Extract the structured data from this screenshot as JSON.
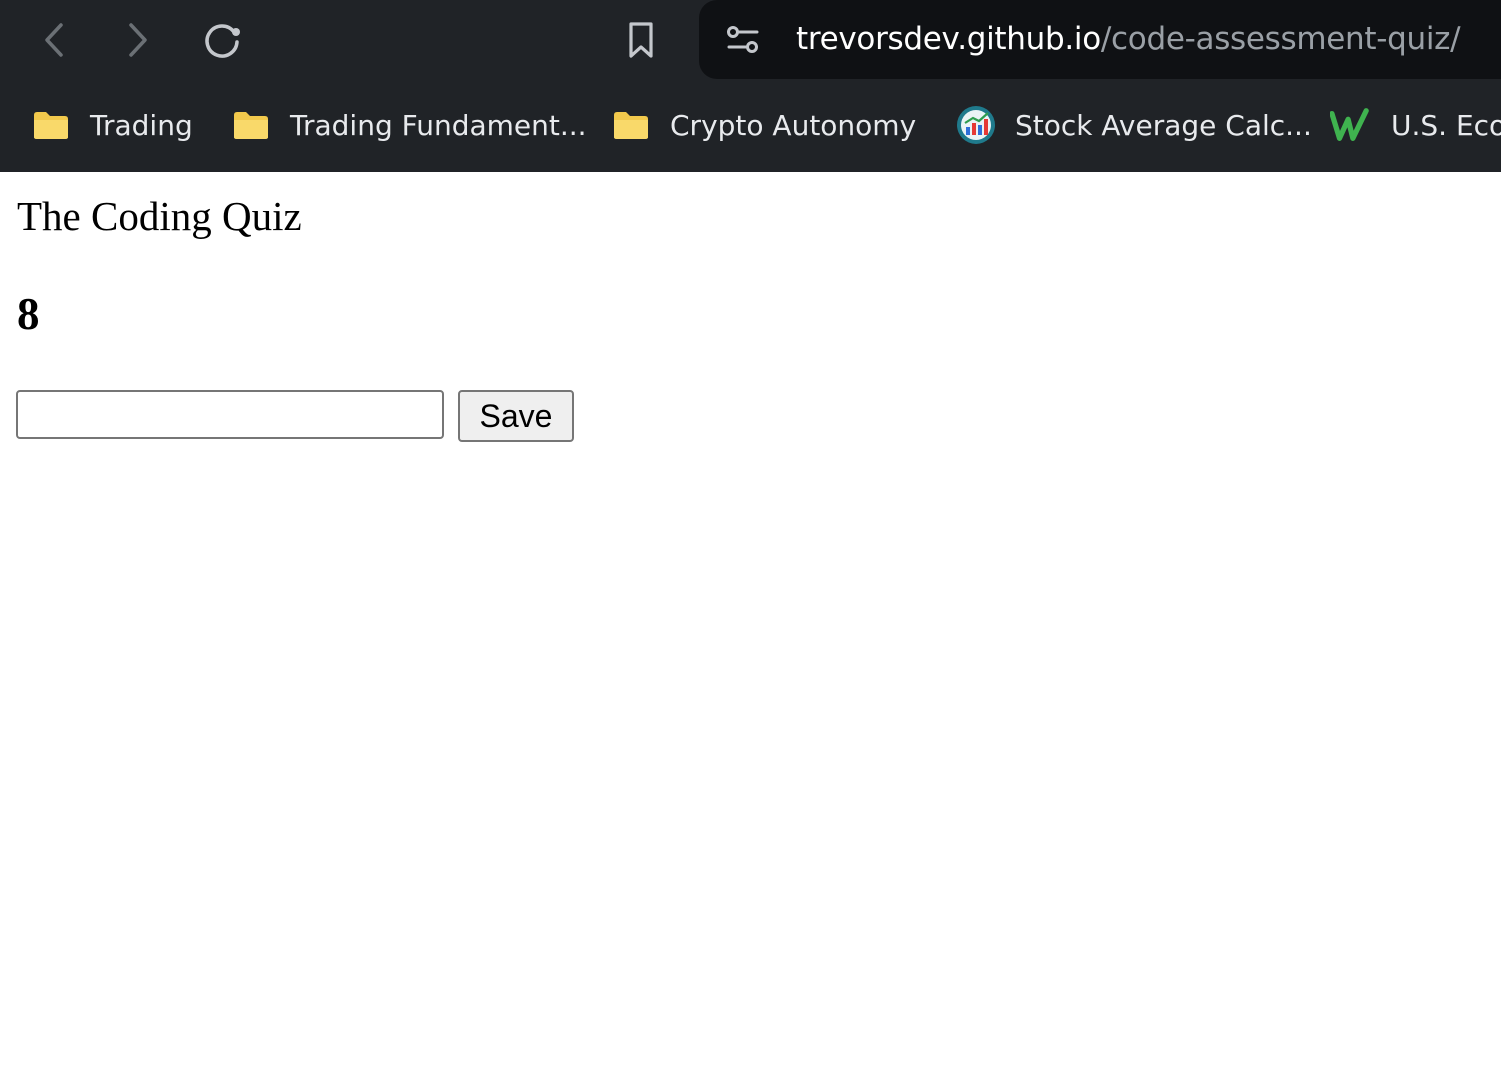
{
  "browser": {
    "url_host": "trevorsdev.github.io",
    "url_path": "/code-assessment-quiz/",
    "bookmarks": [
      {
        "label": "Trading",
        "icon": "folder-icon"
      },
      {
        "label": "Trading Fundament...",
        "icon": "folder-icon"
      },
      {
        "label": "Crypto Autonomy",
        "icon": "folder-icon"
      },
      {
        "label": "Stock Average Calc...",
        "icon": "chart-favicon-icon"
      },
      {
        "label": "U.S. Econ",
        "icon": "w-favicon-icon"
      }
    ],
    "colors": {
      "chrome_bg": "#202327",
      "omnibox_bg": "#0f1114",
      "folder": "#f2c94c"
    }
  },
  "page": {
    "title": "The Coding Quiz",
    "score": "8",
    "initials_value": "",
    "save_label": "Save"
  }
}
